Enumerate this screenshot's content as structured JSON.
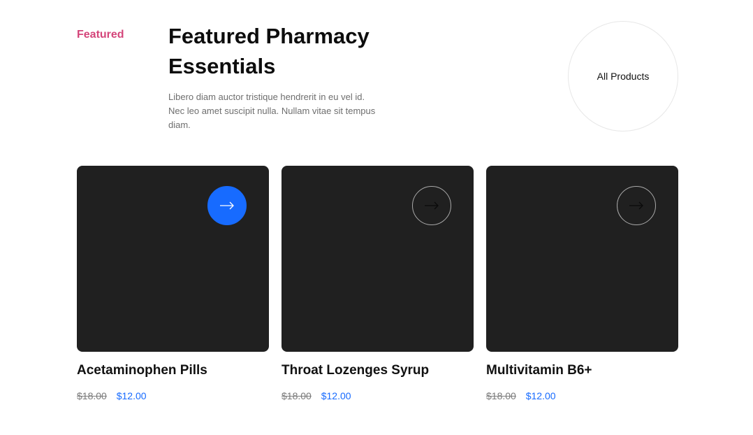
{
  "section": {
    "eyebrow": "Featured",
    "title": "Featured Pharmacy Essentials",
    "description": "Libero diam auctor tristique hendrerit in eu vel id. Nec leo amet suscipit nulla. Nullam vitae sit tempus diam.",
    "all_products_label": "All Products"
  },
  "colors": {
    "accent_pink": "#d4457a",
    "primary_blue": "#176bff",
    "card_background": "#202020"
  },
  "products": [
    {
      "name": "Acetaminophen Pills",
      "old_price": "$18.00",
      "price": "$12.00",
      "icon": "arrow-right-icon",
      "button_state": "active"
    },
    {
      "name": "Throat Lozenges Syrup",
      "old_price": "$18.00",
      "price": "$12.00",
      "icon": "arrow-right-icon",
      "button_state": "default"
    },
    {
      "name": "Multivitamin B6+",
      "old_price": "$18.00",
      "price": "$12.00",
      "icon": "arrow-right-icon",
      "button_state": "default"
    }
  ]
}
